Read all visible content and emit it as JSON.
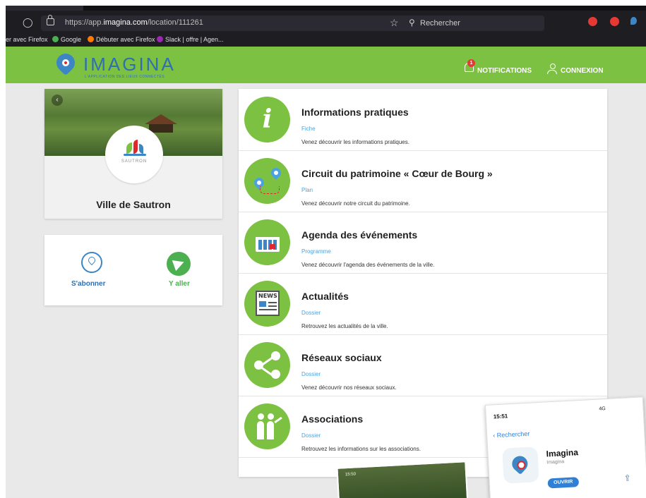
{
  "browser": {
    "url_prefix": "https://app.",
    "url_host": "imagina.com",
    "url_path": "/location/111261",
    "search_placeholder": "Rechercher",
    "bookmarks": [
      "er avec Firefox",
      "Google",
      "Débuter avec Firefox",
      "Slack | offre | Agen..."
    ]
  },
  "header": {
    "brand": "IMAGINA",
    "tagline": "L'APPLICATION DES LIEUX CONNECTÉS",
    "notifications_label": "NOTIFICATIONS",
    "notifications_count": "1",
    "login_label": "CONNEXION",
    "accent_color": "#7dc143"
  },
  "place": {
    "emblem_caption": "SAUTRON",
    "name": "Ville de Sautron",
    "subscribe_label": "S'abonner",
    "go_label": "Y aller"
  },
  "items": [
    {
      "title": "Informations pratiques",
      "type": "Fiche",
      "desc": "Venez découvrir les informations pratiques.",
      "icon": "info-icon"
    },
    {
      "title": "Circuit du patrimoine « Cœur de Bourg »",
      "type": "Plan",
      "desc": "Venez découvrir notre circuit du patrimoine.",
      "icon": "map-pins-icon"
    },
    {
      "title": "Agenda des événements",
      "type": "Programme",
      "desc": "Venez découvrir l'agenda des événements de la ville.",
      "icon": "calendar-icon"
    },
    {
      "title": "Actualités",
      "type": "Dossier",
      "desc": "Retrouvez les actualités de la ville.",
      "icon": "newspaper-icon"
    },
    {
      "title": "Réseaux sociaux",
      "type": "Dossier",
      "desc": "Venez découvrir nos réseaux sociaux.",
      "icon": "share-icon"
    },
    {
      "title": "Associations",
      "type": "Dossier",
      "desc": "Retrouvez les informations sur les associations.",
      "icon": "people-icon"
    }
  ],
  "overlay": {
    "small_time": "15:50",
    "time": "15:51",
    "signal": "4G",
    "back_label": "Rechercher",
    "app_name": "Imagina",
    "developer": "Imagina",
    "open_label": "OUVRIR"
  }
}
